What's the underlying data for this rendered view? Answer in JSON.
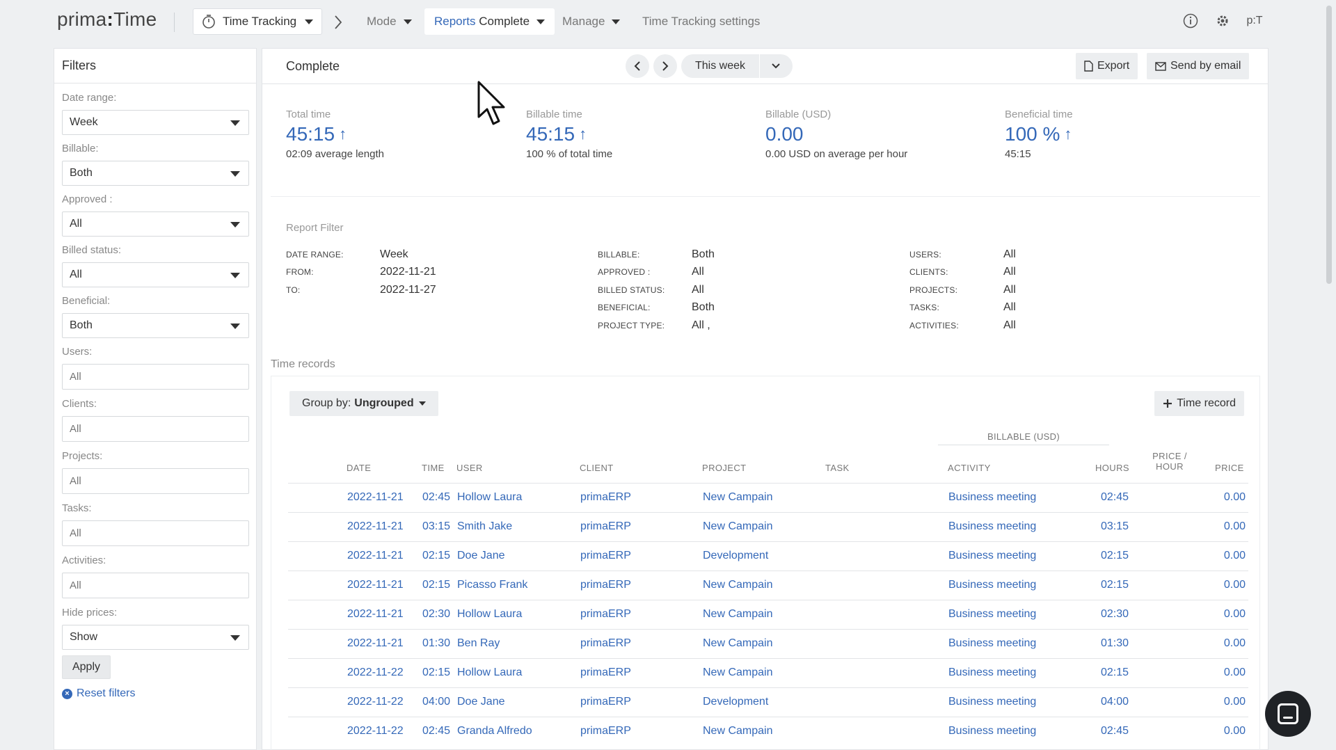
{
  "brand": {
    "logo_left": "prima",
    "logo_colon": ":",
    "logo_right": "Time"
  },
  "topnav": {
    "time_tracking": "Time Tracking",
    "mode": "Mode",
    "reports_prefix": "Reports",
    "reports_current": "Complete",
    "manage": "Manage",
    "settings": "Time Tracking settings",
    "user_initials": "p:T"
  },
  "sidebar": {
    "title": "Filters",
    "date_range_label": "Date range:",
    "date_range_value": "Week",
    "billable_label": "Billable:",
    "billable_value": "Both",
    "approved_label": "Approved :",
    "approved_value": "All",
    "billed_label": "Billed status:",
    "billed_value": "All",
    "beneficial_label": "Beneficial:",
    "beneficial_value": "Both",
    "users_label": "Users:",
    "users_placeholder": "All",
    "clients_label": "Clients:",
    "clients_placeholder": "All",
    "projects_label": "Projects:",
    "projects_placeholder": "All",
    "tasks_label": "Tasks:",
    "tasks_placeholder": "All",
    "activities_label": "Activities:",
    "activities_placeholder": "All",
    "hide_prices_label": "Hide prices:",
    "hide_prices_value": "Show",
    "apply": "Apply",
    "reset": "Reset filters"
  },
  "main": {
    "title": "Complete",
    "period": "This week",
    "export": "Export",
    "send_email": "Send by email"
  },
  "stats": {
    "total_label": "Total time",
    "total_value": "45:15",
    "total_sub": "02:09 average length",
    "billable_label": "Billable time",
    "billable_value": "45:15",
    "billable_sub": "100 % of total time",
    "usd_label": "Billable (USD)",
    "usd_value": "0.00",
    "usd_sub": "0.00 USD on average per hour",
    "beneficial_label": "Beneficial time",
    "beneficial_value": "100 %",
    "beneficial_sub": "45:15"
  },
  "report_filter": {
    "title": "Report Filter",
    "date_range_k": "DATE RANGE:",
    "date_range_v": "Week",
    "from_k": "FROM:",
    "from_v": "2022-11-21",
    "to_k": "TO:",
    "to_v": "2022-11-27",
    "billable_k": "BILLABLE:",
    "billable_v": "Both",
    "approved_k": "APPROVED :",
    "approved_v": "All",
    "billed_k": "BILLED STATUS:",
    "billed_v": "All",
    "beneficial_k": "BENEFICIAL:",
    "beneficial_v": "Both",
    "ptype_k": "PROJECT TYPE:",
    "ptype_v": "All ,",
    "users_k": "USERS:",
    "users_v": "All",
    "clients_k": "CLIENTS:",
    "clients_v": "All",
    "projects_k": "PROJECTS:",
    "projects_v": "All",
    "tasks_k": "TASKS:",
    "tasks_v": "All",
    "activities_k": "ACTIVITIES:",
    "activities_v": "All"
  },
  "records": {
    "title": "Time records",
    "group_by_label": "Group by:",
    "group_by_value": "Ungrouped",
    "add_label": "Time record",
    "billable_header": "BILLABLE (USD)",
    "columns": {
      "date": "DATE",
      "time": "TIME",
      "user": "USER",
      "client": "CLIENT",
      "project": "PROJECT",
      "task": "TASK",
      "activity": "ACTIVITY",
      "hours": "HOURS",
      "price_hour_1": "PRICE /",
      "price_hour_2": "HOUR",
      "price": "PRICE"
    },
    "rows": [
      {
        "date": "2022-11-21",
        "time": "02:45",
        "user": "Hollow Laura",
        "client": "primaERP",
        "project": "New Campain",
        "task": "",
        "activity": "Business meeting",
        "hours": "02:45",
        "price": "0.00"
      },
      {
        "date": "2022-11-21",
        "time": "03:15",
        "user": "Smith Jake",
        "client": "primaERP",
        "project": "New Campain",
        "task": "",
        "activity": "Business meeting",
        "hours": "03:15",
        "price": "0.00"
      },
      {
        "date": "2022-11-21",
        "time": "02:15",
        "user": "Doe Jane",
        "client": "primaERP",
        "project": "Development",
        "task": "",
        "activity": "Business meeting",
        "hours": "02:15",
        "price": "0.00"
      },
      {
        "date": "2022-11-21",
        "time": "02:15",
        "user": "Picasso Frank",
        "client": "primaERP",
        "project": "New Campain",
        "task": "",
        "activity": "Business meeting",
        "hours": "02:15",
        "price": "0.00"
      },
      {
        "date": "2022-11-21",
        "time": "02:30",
        "user": "Hollow Laura",
        "client": "primaERP",
        "project": "New Campain",
        "task": "",
        "activity": "Business meeting",
        "hours": "02:30",
        "price": "0.00"
      },
      {
        "date": "2022-11-21",
        "time": "01:30",
        "user": "Ben Ray",
        "client": "primaERP",
        "project": "New Campain",
        "task": "",
        "activity": "Business meeting",
        "hours": "01:30",
        "price": "0.00"
      },
      {
        "date": "2022-11-22",
        "time": "02:15",
        "user": "Hollow Laura",
        "client": "primaERP",
        "project": "New Campain",
        "task": "",
        "activity": "Business meeting",
        "hours": "02:15",
        "price": "0.00"
      },
      {
        "date": "2022-11-22",
        "time": "04:00",
        "user": "Doe Jane",
        "client": "primaERP",
        "project": "Development",
        "task": "",
        "activity": "Business meeting",
        "hours": "04:00",
        "price": "0.00"
      },
      {
        "date": "2022-11-22",
        "time": "02:45",
        "user": "Granda Alfredo",
        "client": "primaERP",
        "project": "New Campain",
        "task": "",
        "activity": "Business meeting",
        "hours": "02:45",
        "price": "0.00"
      }
    ]
  },
  "colors": {
    "accent": "#3468b8",
    "background": "#eef0f2"
  },
  "icons": [
    "stopwatch-icon",
    "chevron-right-icon",
    "info-icon",
    "gear-icon",
    "file-icon",
    "mail-icon",
    "plus-icon",
    "close-circle-icon",
    "chat-icon",
    "mouse-cursor-icon"
  ]
}
